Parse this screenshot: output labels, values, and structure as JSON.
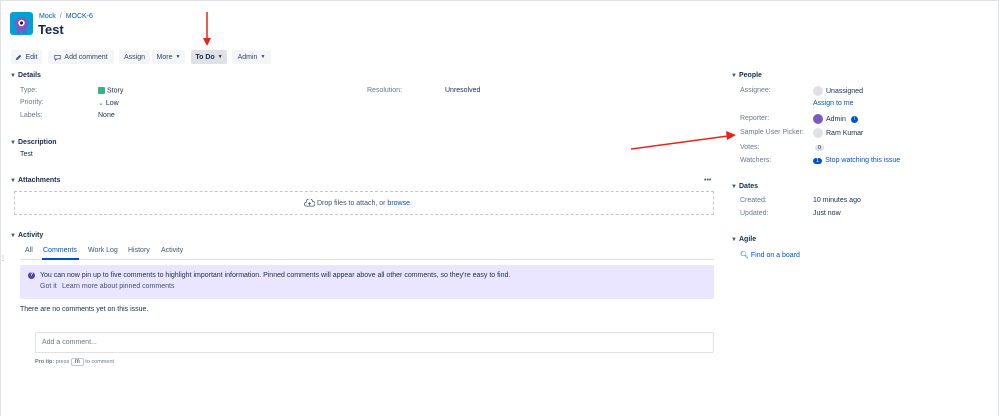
{
  "breadcrumb": {
    "project": "Mock",
    "issue_key": "MOCK-6"
  },
  "issue": {
    "title": "Test"
  },
  "toolbar": {
    "edit": "Edit",
    "add_comment": "Add comment",
    "assign": "Assign",
    "more": "More",
    "status": "To Do",
    "admin": "Admin"
  },
  "details": {
    "heading": "Details",
    "type_label": "Type:",
    "type_value": "Story",
    "priority_label": "Priority:",
    "priority_value": "Low",
    "labels_label": "Labels:",
    "labels_value": "None",
    "resolution_label": "Resolution:",
    "resolution_value": "Unresolved"
  },
  "description": {
    "heading": "Description",
    "text": "Test"
  },
  "attachments": {
    "heading": "Attachments",
    "more": "•••",
    "drop_text": "Drop files to attach, or ",
    "browse": "browse."
  },
  "activity": {
    "heading": "Activity",
    "tabs": [
      "All",
      "Comments",
      "Work Log",
      "History",
      "Activity"
    ],
    "active_tab": "Comments",
    "info_message": "You can now pin up to five comments to highlight important information. Pinned comments will appear above all other comments, so they're easy to find.",
    "got_it": "Got it",
    "learn_more": "Learn more about pinned comments",
    "no_comments": "There are no comments yet on this issue.",
    "comment_placeholder": "Add a comment...",
    "pro_tip_prefix": "Pro tip:",
    "pro_tip_press": "press",
    "pro_tip_key": "m",
    "pro_tip_suffix": "to comment"
  },
  "people": {
    "heading": "People",
    "assignee_label": "Assignee:",
    "assignee_value": "Unassigned",
    "assign_to_me": "Assign to me",
    "reporter_label": "Reporter:",
    "reporter_value": "Admin",
    "picker_label": "Sample User Picker:",
    "picker_value": "Ram Kumar",
    "votes_label": "Votes:",
    "votes_value": "0",
    "watchers_label": "Watchers:",
    "watchers_count": "1",
    "watchers_link": "Stop watching this issue"
  },
  "dates": {
    "heading": "Dates",
    "created_label": "Created:",
    "created_value": "10 minutes ago",
    "updated_label": "Updated:",
    "updated_value": "Just now"
  },
  "agile": {
    "heading": "Agile",
    "find_board": "Find on a board"
  },
  "colors": {
    "link": "#0052cc",
    "annotation_arrow": "#e8231a",
    "info_bg": "#eae6ff",
    "story_green": "#36b37e"
  }
}
